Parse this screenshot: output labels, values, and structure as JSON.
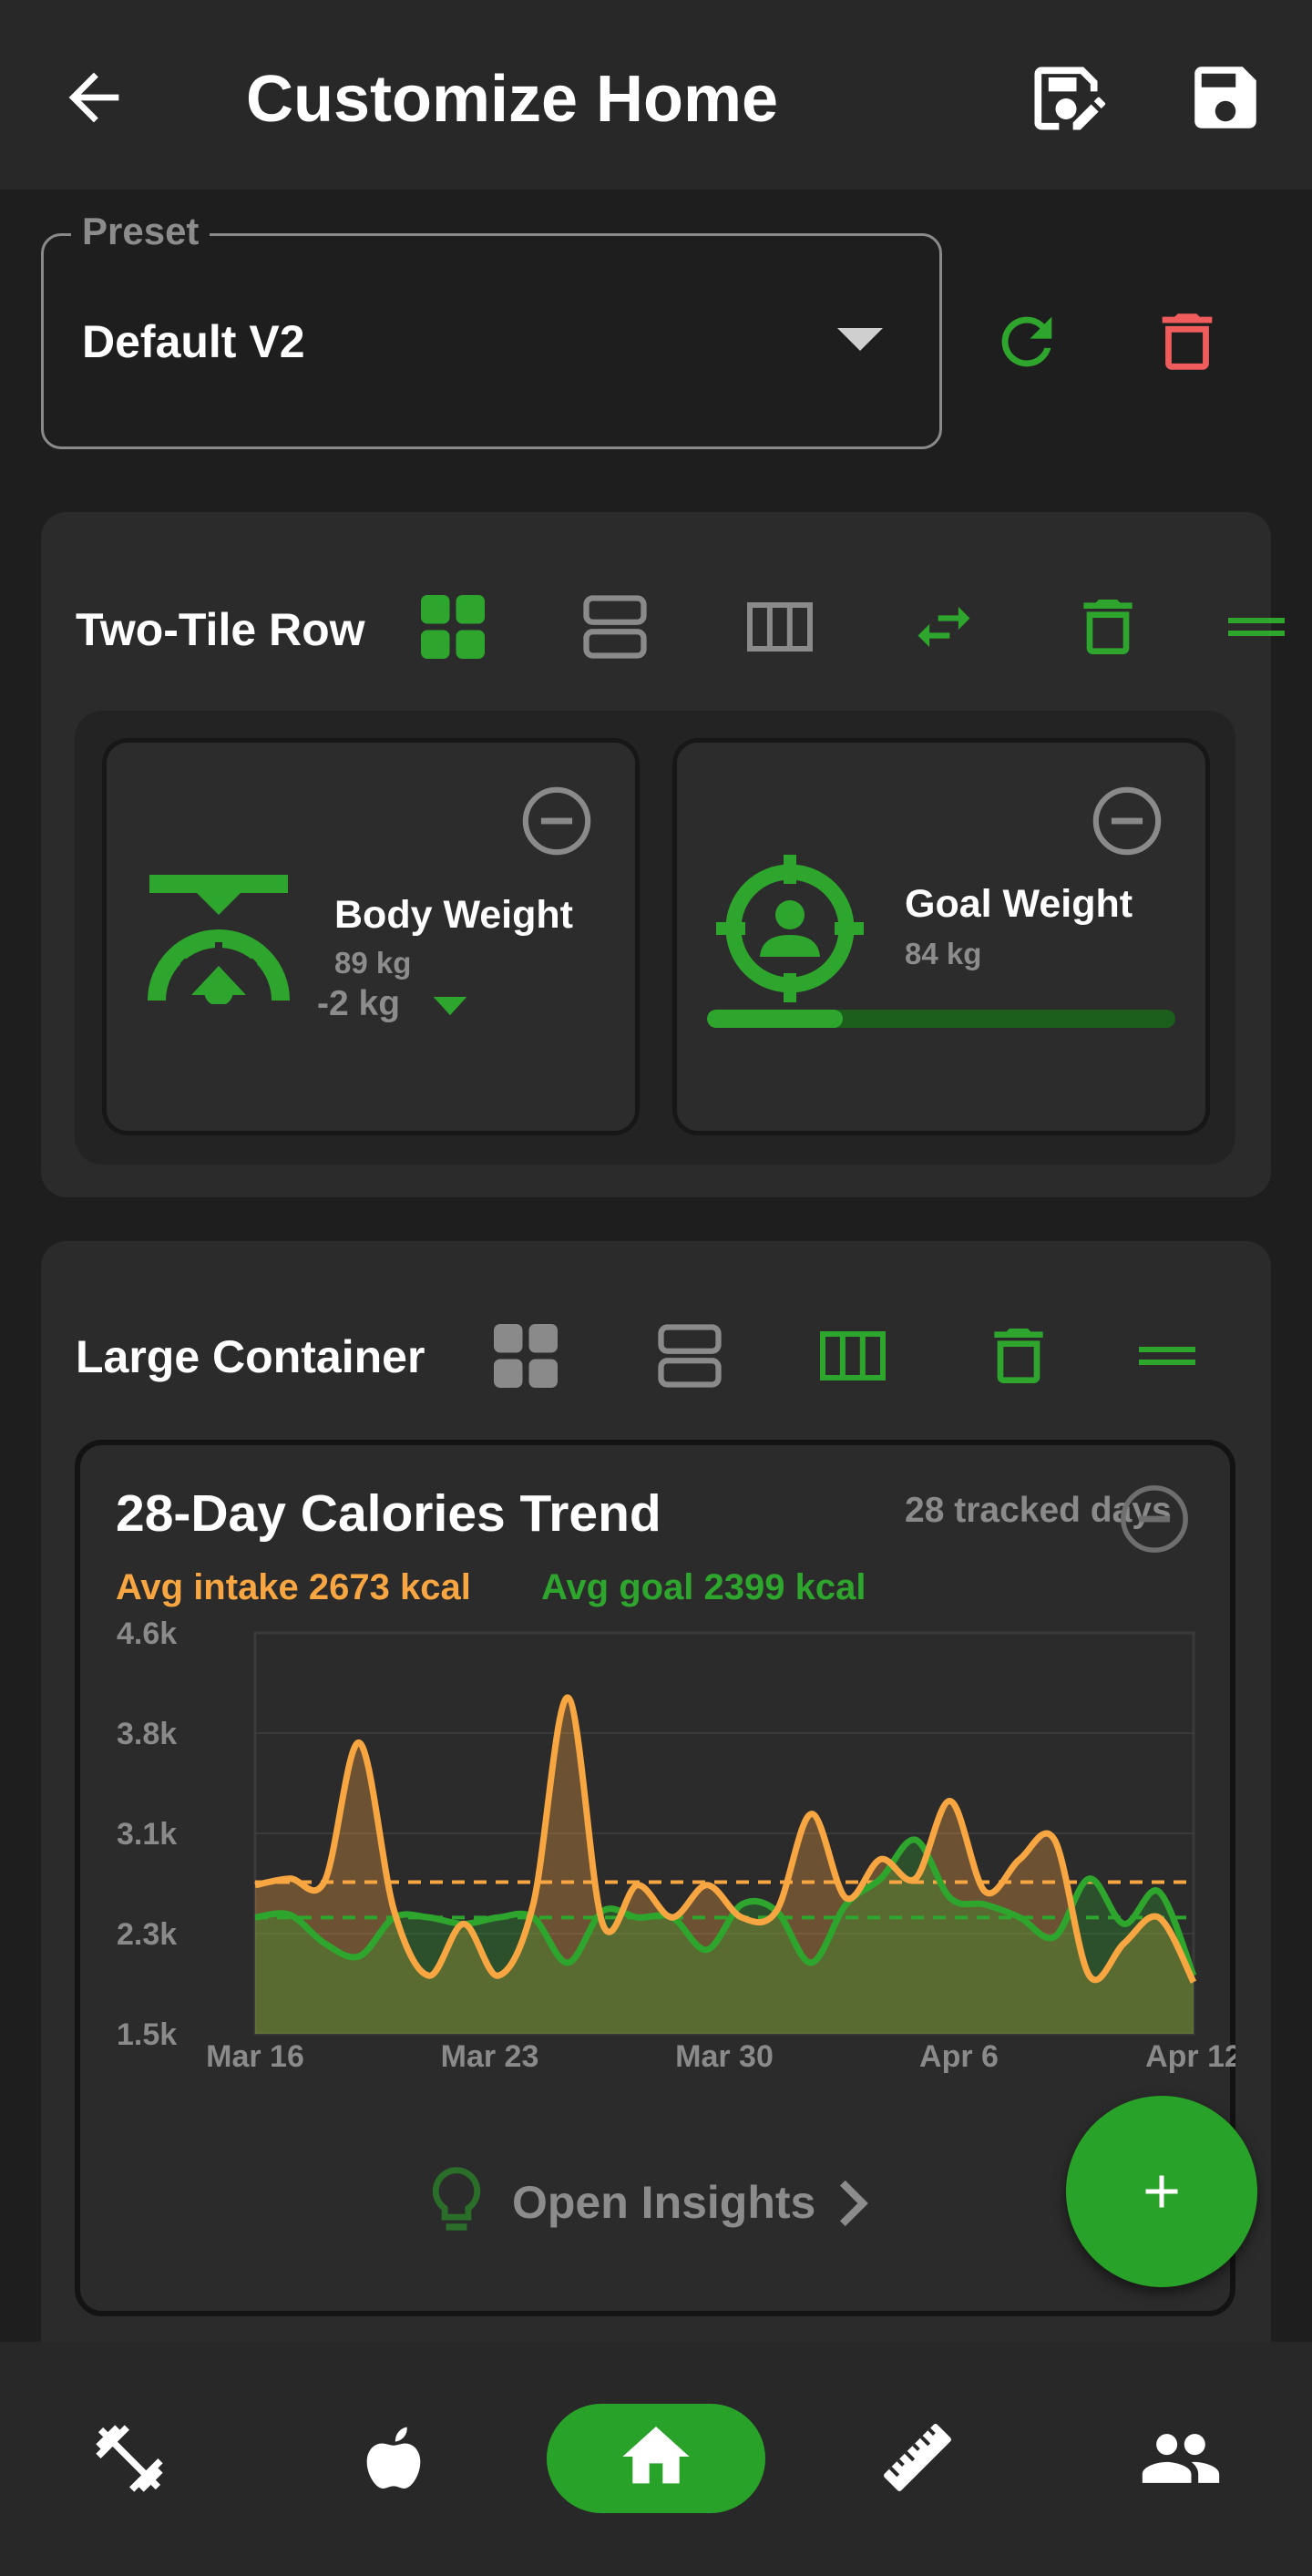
{
  "app_bar": {
    "title": "Customize Home",
    "icons": [
      "arrow-back-icon",
      "save-edit-icon",
      "save-icon"
    ]
  },
  "preset": {
    "legend": "Preset",
    "value": "Default V2",
    "icons": [
      "dropdown-arrow-icon",
      "refresh-icon",
      "delete-icon"
    ]
  },
  "two_tile_row": {
    "title": "Two-Tile Row",
    "layout_icons": [
      "grid-layout-icon",
      "rows-layout-icon",
      "columns-layout-icon",
      "swap-icon",
      "delete-icon",
      "drag-handle-icon"
    ],
    "selected_layout": "grid",
    "tiles": [
      {
        "name": "Body Weight",
        "value": "89 kg",
        "change": "-2 kg",
        "icon": "scale-icon",
        "trend_icon": "down-triangle-icon"
      },
      {
        "name": "Goal Weight",
        "value": "84 kg",
        "icon": "target-person-icon",
        "progress": 0.29
      }
    ]
  },
  "large_container": {
    "title": "Large Container",
    "layout_icons": [
      "grid-layout-icon",
      "rows-layout-icon",
      "columns-layout-icon",
      "delete-icon",
      "drag-handle-icon"
    ],
    "selected_layout": "columns"
  },
  "calorie_card": {
    "title": "28-Day Calories Trend",
    "subtitle": "28 tracked days",
    "avg_intake_label": "Avg intake 2673 kcal",
    "avg_goal_label": "Avg goal 2399 kcal",
    "insights_label": "Open Insights",
    "icons": [
      "remove-circle-icon",
      "lightbulb-icon",
      "chevron-right-icon"
    ]
  },
  "chart_data": {
    "type": "area",
    "title": "28-Day Calories Trend",
    "xlabel": "",
    "ylabel": "",
    "x_ticks": [
      "Mar 16",
      "Mar 23",
      "Mar 30",
      "Apr 6",
      "Apr 12"
    ],
    "y_ticks": [
      "1.5k",
      "2.3k",
      "3.1k",
      "3.8k",
      "4.6k"
    ],
    "ylim": [
      1500,
      4600
    ],
    "grid": true,
    "x": [
      "Mar 16",
      "Mar 17",
      "Mar 18",
      "Mar 19",
      "Mar 20",
      "Mar 21",
      "Mar 22",
      "Mar 23",
      "Mar 24",
      "Mar 25",
      "Mar 26",
      "Mar 27",
      "Mar 28",
      "Mar 29",
      "Mar 30",
      "Mar 31",
      "Apr 1",
      "Apr 2",
      "Apr 3",
      "Apr 4",
      "Apr 5",
      "Apr 6",
      "Apr 7",
      "Apr 8",
      "Apr 9",
      "Apr 10",
      "Apr 11",
      "Apr 12"
    ],
    "series": [
      {
        "values": [
          2650,
          2700,
          2680,
          3750,
          2450,
          1950,
          2350,
          1950,
          2500,
          4100,
          2350,
          2650,
          2400,
          2650,
          2400,
          2450,
          3200,
          2550,
          2850,
          2700,
          3300,
          2600,
          2850,
          3000,
          1950,
          2200,
          2400,
          1900
        ],
        "color": "#f7a641",
        "average": 2673
      },
      {
        "values": [
          2400,
          2420,
          2200,
          2100,
          2400,
          2400,
          2350,
          2400,
          2400,
          2050,
          2450,
          2400,
          2400,
          2150,
          2500,
          2450,
          2050,
          2500,
          2700,
          3000,
          2550,
          2500,
          2400,
          2250,
          2700,
          2350,
          2600,
          1950
        ],
        "color": "#2ea62e",
        "average": 2399
      }
    ]
  },
  "bottom_nav": {
    "items": [
      "dumbbell-icon",
      "apple-icon",
      "home-icon",
      "ruler-icon",
      "people-icon"
    ],
    "active": "home-icon"
  }
}
